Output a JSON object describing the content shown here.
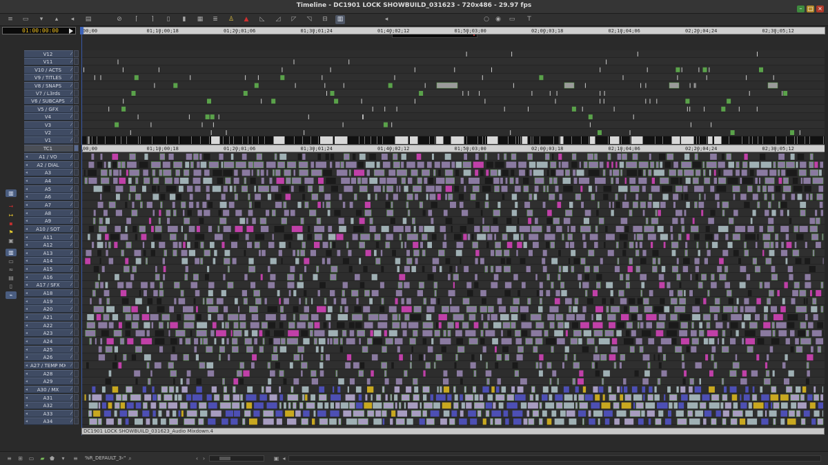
{
  "window": {
    "title": "Timeline - DC1901 LOCK SHOWBUILD_031623 - 720x486 - 29.97 fps",
    "controls": [
      "minimize-icon",
      "maximize-icon",
      "close-icon"
    ],
    "colors": {
      "minimize": "#3e8a3e",
      "maximize": "#b48a2a",
      "close": "#b03a2a"
    }
  },
  "toolbar": {
    "left_buttons": [
      "menu-icon",
      "bin-icon",
      "arrow-down-icon",
      "arrow-up-icon",
      "speaker-icon",
      "film-icon",
      "no-entry-icon",
      "mark-in-icon",
      "mark-out-icon",
      "clear-marks-icon",
      "splice-icon",
      "overwrite-icon",
      "lift-icon",
      "extract-icon",
      "record-icon",
      "segment-trim-icon",
      "segment-red-icon",
      "fade-icon",
      "slip-icon",
      "add-edit-icon",
      "trim-icon",
      "timeline-view-icon"
    ],
    "right_buttons": [
      "volume-icon",
      "circle-icon",
      "record-button-icon",
      "camera-icon",
      "text-tool-icon"
    ]
  },
  "master_timecode": "01:00:00:00",
  "ruler": {
    "ticks": [
      "00;00",
      "01;10;00;18",
      "01;20;01;06",
      "01;30;01;24",
      "01;40;02;12",
      "01;50;03;00",
      "02;00;03;18",
      "02;10;04;06",
      "02;20;04;24",
      "02;30;05;12"
    ]
  },
  "tc_ruler": {
    "ticks": [
      "00;00",
      "01;10;00;18",
      "01;20;01;06",
      "01;30;01;24",
      "01;40;02;12",
      "01;50;03;00",
      "02;00;03;18",
      "02;10;04;06",
      "02;20;04;24",
      "02;30;05;12"
    ]
  },
  "video_tracks": [
    "V12",
    "V11",
    "V10 / ACTS",
    "V9 / TITLES",
    "V8 / SNAPS",
    "V7 / L3rds",
    "V6 / SUBCAPS",
    "V5 / GFX",
    "V4",
    "V3",
    "V2",
    "V1"
  ],
  "tc_track": "TC1",
  "audio_tracks": [
    "A1 / VO",
    "A2 / DIAL",
    "A3",
    "A4",
    "A5",
    "A6",
    "A7",
    "A8",
    "A9",
    "A10 / SOT",
    "A11",
    "A12",
    "A13",
    "A14",
    "A15",
    "A16",
    "A17 / SFX",
    "A18",
    "A19",
    "A20",
    "A21",
    "A22",
    "A23",
    "A24",
    "A25",
    "A26",
    "A27 / TEMP MX",
    "A28",
    "A29",
    "A30 / MX",
    "A31",
    "A32",
    "A33",
    "A34"
  ],
  "left_strip": [
    "timeline-view-icon",
    "red-arrow-icon",
    "yellow-arrow-icon",
    "red-marker-icon",
    "yellow-flag-icon",
    "image-icon",
    "audio-view-icon",
    "display-icon",
    "waveform-icon",
    "settings-icon",
    "clip-icon",
    "link-icon",
    "razor-icon"
  ],
  "status_line": "DC1901 LOCK SHOWBUILD_031623_Audio Mixdown.4",
  "footer": {
    "setting_name": "%R_DEFAULT_3‹\"",
    "buttons": [
      "menu-icon",
      "grid-icon",
      "monitor-icon",
      "bin-icon",
      "shield-icon",
      "chevron-down-icon",
      "settings-icon",
      "search-icon",
      "arrow-left-icon",
      "arrow-right-icon",
      "zoom-out-icon",
      "zoom-in-icon"
    ]
  },
  "clip_colors": {
    "audio_clip": "#8a7aa0",
    "audio_clip_light": "#a79cc0",
    "effect_green": "#5aa24a",
    "pink": "#c040a8",
    "blue": "#4d4fb4",
    "yellow": "#c8a820",
    "cyan_gray": "#9fb0b4"
  }
}
